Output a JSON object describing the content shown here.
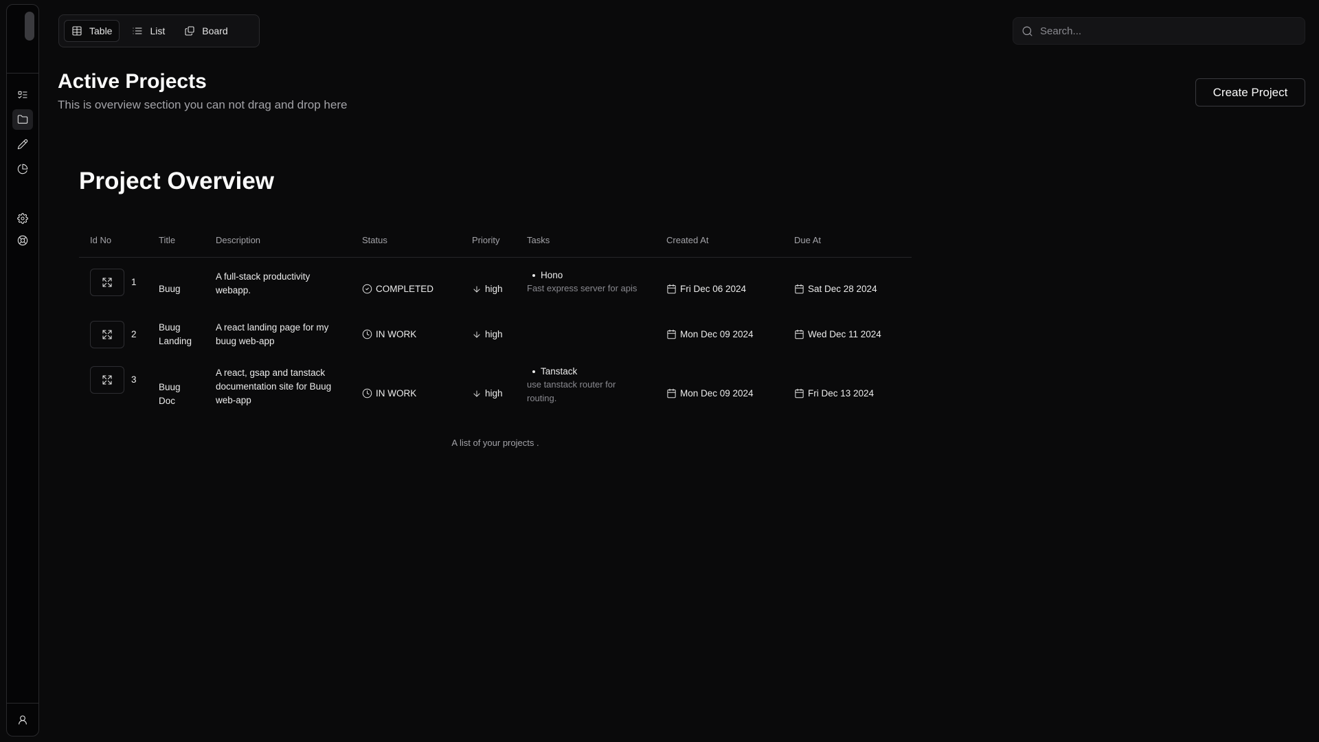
{
  "sidebar": {
    "icons": [
      "list-todo-icon",
      "folder-icon",
      "pencil-icon",
      "pie-chart-icon",
      "settings-icon",
      "help-circle-icon",
      "user-icon"
    ]
  },
  "views": {
    "tabs": [
      {
        "label": "Table",
        "icon": "table-icon",
        "active": true
      },
      {
        "label": "List",
        "icon": "list-icon",
        "active": false
      },
      {
        "label": "Board",
        "icon": "board-icon",
        "active": false
      }
    ]
  },
  "search": {
    "placeholder": "Search..."
  },
  "header": {
    "title": "Active Projects",
    "subtitle": "This is overview section you can not drag and drop here",
    "create_label": "Create Project"
  },
  "overview": {
    "title": "Project Overview",
    "columns": [
      "Id No",
      "Title",
      "Description",
      "Status",
      "Priority",
      "Tasks",
      "Created At",
      "Due At"
    ],
    "rows": [
      {
        "id": "1",
        "title": "Buug",
        "description": "A full-stack productivity webapp.",
        "status": "COMPLETED",
        "status_icon": "check-circle-icon",
        "priority": "high",
        "task_name": "Hono",
        "task_desc": "Fast express server for apis",
        "created": "Fri Dec 06 2024",
        "due": "Sat Dec 28 2024"
      },
      {
        "id": "2",
        "title": "Buug Landing",
        "description": "A react landing page for my buug web-app",
        "status": "IN WORK",
        "status_icon": "clock-icon",
        "priority": "high",
        "task_name": "",
        "task_desc": "",
        "created": "Mon Dec 09 2024",
        "due": "Wed Dec 11 2024"
      },
      {
        "id": "3",
        "title": "Buug Doc",
        "description": "A react, gsap and tanstack documentation site for Buug web-app",
        "status": "IN WORK",
        "status_icon": "clock-icon",
        "priority": "high",
        "task_name": "Tanstack",
        "task_desc": "use tanstack router for routing.",
        "created": "Mon Dec 09 2024",
        "due": "Fri Dec 13 2024"
      }
    ],
    "caption": "A list of your projects ."
  }
}
